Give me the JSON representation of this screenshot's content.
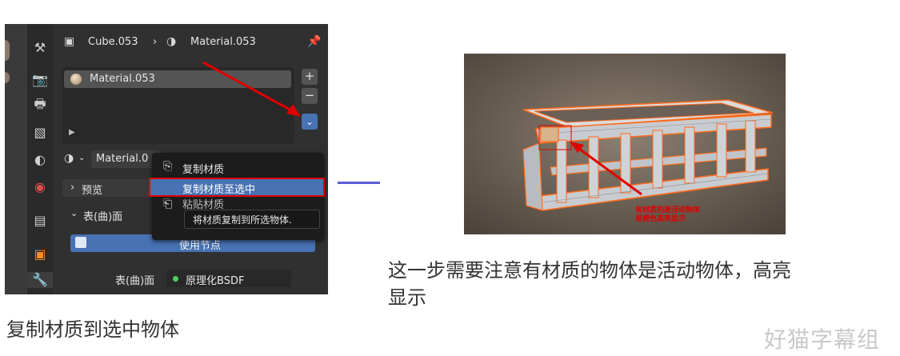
{
  "blender": {
    "breadcrumb": {
      "object": "Cube.053",
      "material": "Material.053"
    },
    "material_slot": {
      "name": "Material.053"
    },
    "side_buttons": {
      "add": "+",
      "remove": "−",
      "menu": "⌄"
    },
    "browse": {
      "name": "Material.0"
    },
    "preview_label": "预览",
    "surface_section": "表(曲)面",
    "use_nodes_label": "使用节点",
    "surface_label": "表(曲)面",
    "surface_value": "原理化BSDF",
    "dropdown": {
      "items": [
        {
          "label": "复制材质"
        },
        {
          "label": "复制材质至选中"
        },
        {
          "label": "粘贴材质"
        }
      ],
      "tooltip": "将材质复制到所选物体."
    }
  },
  "captions": {
    "left": "复制材质到选中物体",
    "right_line1": "这一步需要注意有材质的物体是活动物体，高亮",
    "right_line2": "显示"
  },
  "render": {
    "annotation_line1": "有材质的是活动物体",
    "annotation_line2": "是橙色高亮显示"
  },
  "watermark": "好猫字幕组",
  "colors": {
    "accent": "#4772b3",
    "highlight_red": "#e00000",
    "divider": "#5a5bd6",
    "selection_orange": "#ff6a1a"
  }
}
